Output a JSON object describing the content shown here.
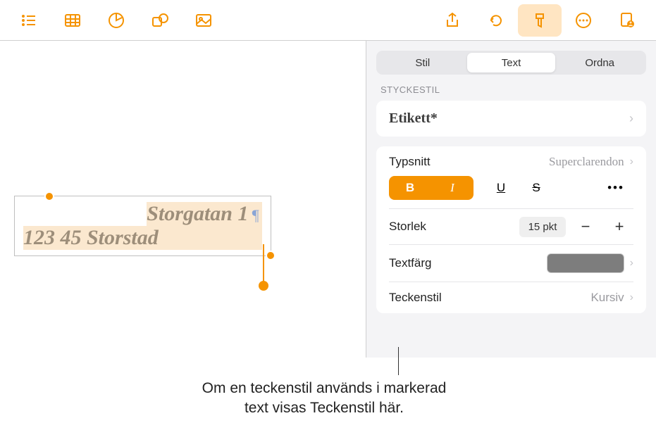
{
  "toolbar": {
    "icons": [
      "list",
      "table",
      "chart",
      "shape",
      "media",
      "share",
      "undo",
      "format",
      "more",
      "collab"
    ]
  },
  "canvas": {
    "line1": "Storgatan 1",
    "line2": "123 45 Storstad"
  },
  "inspector": {
    "tabs": {
      "stil": "Stil",
      "text": "Text",
      "ordna": "Ordna"
    },
    "section_label": "STYCKESTIL",
    "etikett_label": "Etikett*",
    "typsnitt": {
      "label": "Typsnitt",
      "value": "Superclarendon"
    },
    "style_buttons": {
      "bold": "B",
      "italic": "I",
      "underline": "U",
      "strike": "S",
      "more": "•••"
    },
    "storlek": {
      "label": "Storlek",
      "value": "15 pkt",
      "minus": "−",
      "plus": "+"
    },
    "textfarg": {
      "label": "Textfärg",
      "color": "#7d7d7d"
    },
    "teckenstil": {
      "label": "Teckenstil",
      "value": "Kursiv"
    }
  },
  "callout": {
    "line1": "Om en teckenstil används i markerad",
    "line2": "text visas Teckenstil här."
  }
}
